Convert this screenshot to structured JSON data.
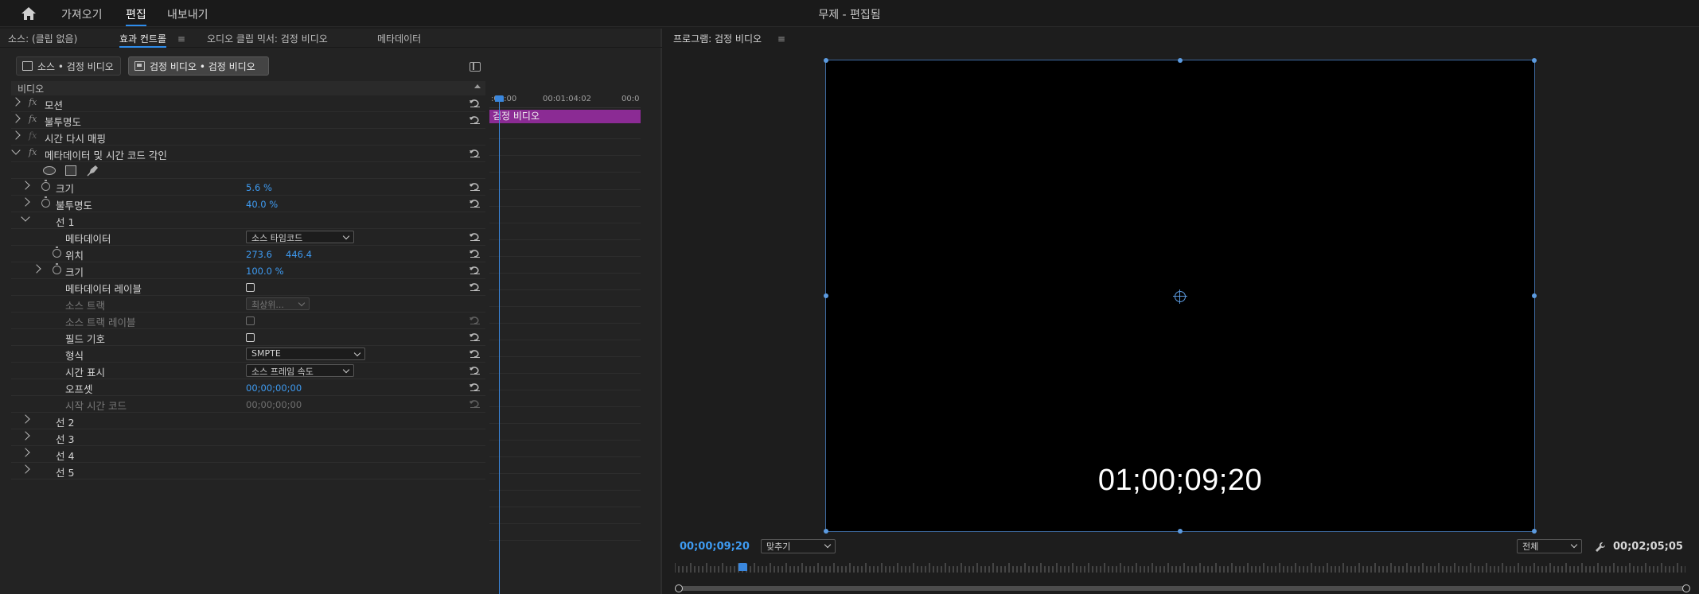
{
  "menu": {
    "items": [
      {
        "label": "가져오기"
      },
      {
        "label": "편집",
        "active": true
      },
      {
        "label": "내보내기"
      }
    ],
    "title": "무제 - 편집됨"
  },
  "left_tabs": {
    "source": "소스: (클립 없음)",
    "effect_controls": "효과 컨트롤",
    "audio_mixer": "오디오 클립 믹서: 검정 비디오",
    "metadata": "메타데이터"
  },
  "clip_selector": {
    "source_clip": "소스 • 검정 비디오",
    "sequence_clip": "검정 비디오 • 검정 비디오"
  },
  "effects": {
    "section": "비디오",
    "motion": "모션",
    "opacity": "불투명도",
    "time_remap": "시간 다시 매핑",
    "burnin": "메타데이터 및 시간 코드 각인",
    "size_label": "크기",
    "size_value": "5.6 %",
    "opacity_label": "불투명도",
    "opacity_value": "40.0 %",
    "line1": "선 1",
    "metadata_label": "메타데이터",
    "metadata_value": "소스 타임코드",
    "position_label": "위치",
    "position_x": "273.6",
    "position_y": "446.4",
    "line_size_label": "크기",
    "line_size_value": "100.0 %",
    "metadata_label_label": "메타데이터 레이블",
    "source_track_label": "소스 트랙",
    "source_track_value": "최상위...",
    "source_track_label_label": "소스 트랙 레이블",
    "field_symbol_label": "필드 기호",
    "format_label": "형식",
    "format_value": "SMPTE",
    "time_display_label": "시간 표시",
    "time_display_value": "소스 프레임 속도",
    "offset_label": "오프셋",
    "offset_value": "00;00;00;00",
    "start_tc_label": "시작 시간 코드",
    "start_tc_value": "00;00;00;00",
    "line2": "선 2",
    "line3": "선 3",
    "line4": "선 4",
    "line5": "선 5"
  },
  "mini_timeline": {
    "tick_start": ":00:00",
    "tick_mid": "00:01:04:02",
    "tick_end": "00:0",
    "clip_label": "검정 비디오"
  },
  "program_monitor": {
    "title": "프로그램: 검정 비디오",
    "burnin_timecode": "01;00;09;20",
    "current_timecode": "00;00;09;20",
    "fit": "맞추기",
    "quality": "전체",
    "duration": "00;02;05;05"
  },
  "colors": {
    "accent": "#2d8ceb",
    "clip": "#8b2b94",
    "value_blue": "#3e9bf2"
  }
}
